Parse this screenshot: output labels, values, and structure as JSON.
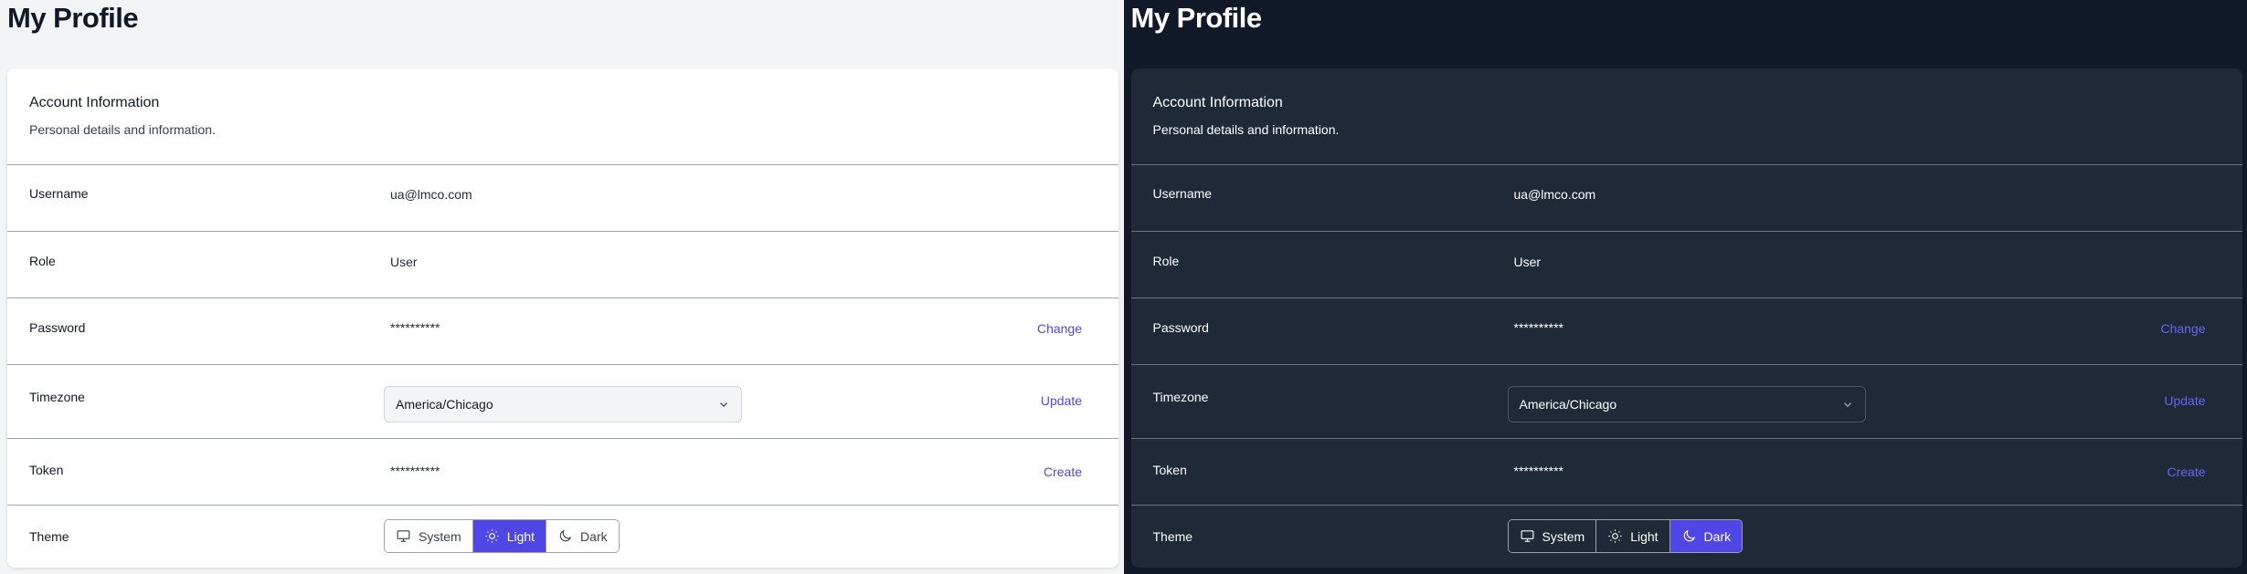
{
  "page": {
    "title": "My Profile"
  },
  "account": {
    "title": "Account Information",
    "subtitle": "Personal details and information."
  },
  "rows": {
    "username": {
      "label": "Username",
      "value": "ua@lmco.com"
    },
    "role": {
      "label": "Role",
      "value": "User"
    },
    "password": {
      "label": "Password",
      "value": "**********",
      "action": "Change"
    },
    "timezone": {
      "label": "Timezone",
      "value": "America/Chicago",
      "action": "Update"
    },
    "token": {
      "label": "Token",
      "value": "**********",
      "action": "Create"
    },
    "theme": {
      "label": "Theme",
      "options": [
        "System",
        "Light",
        "Dark"
      ],
      "selected_light_panel": "Light",
      "selected_dark_panel": "Dark"
    }
  },
  "colors": {
    "accent": "#4f46e5",
    "light_bg": "#f3f4f6",
    "dark_bg": "#111827",
    "dark_card": "#1f2937"
  },
  "icons": {
    "system": "monitor-icon",
    "light": "sun-icon",
    "dark": "moon-icon",
    "select": "chevron-down-icon"
  }
}
